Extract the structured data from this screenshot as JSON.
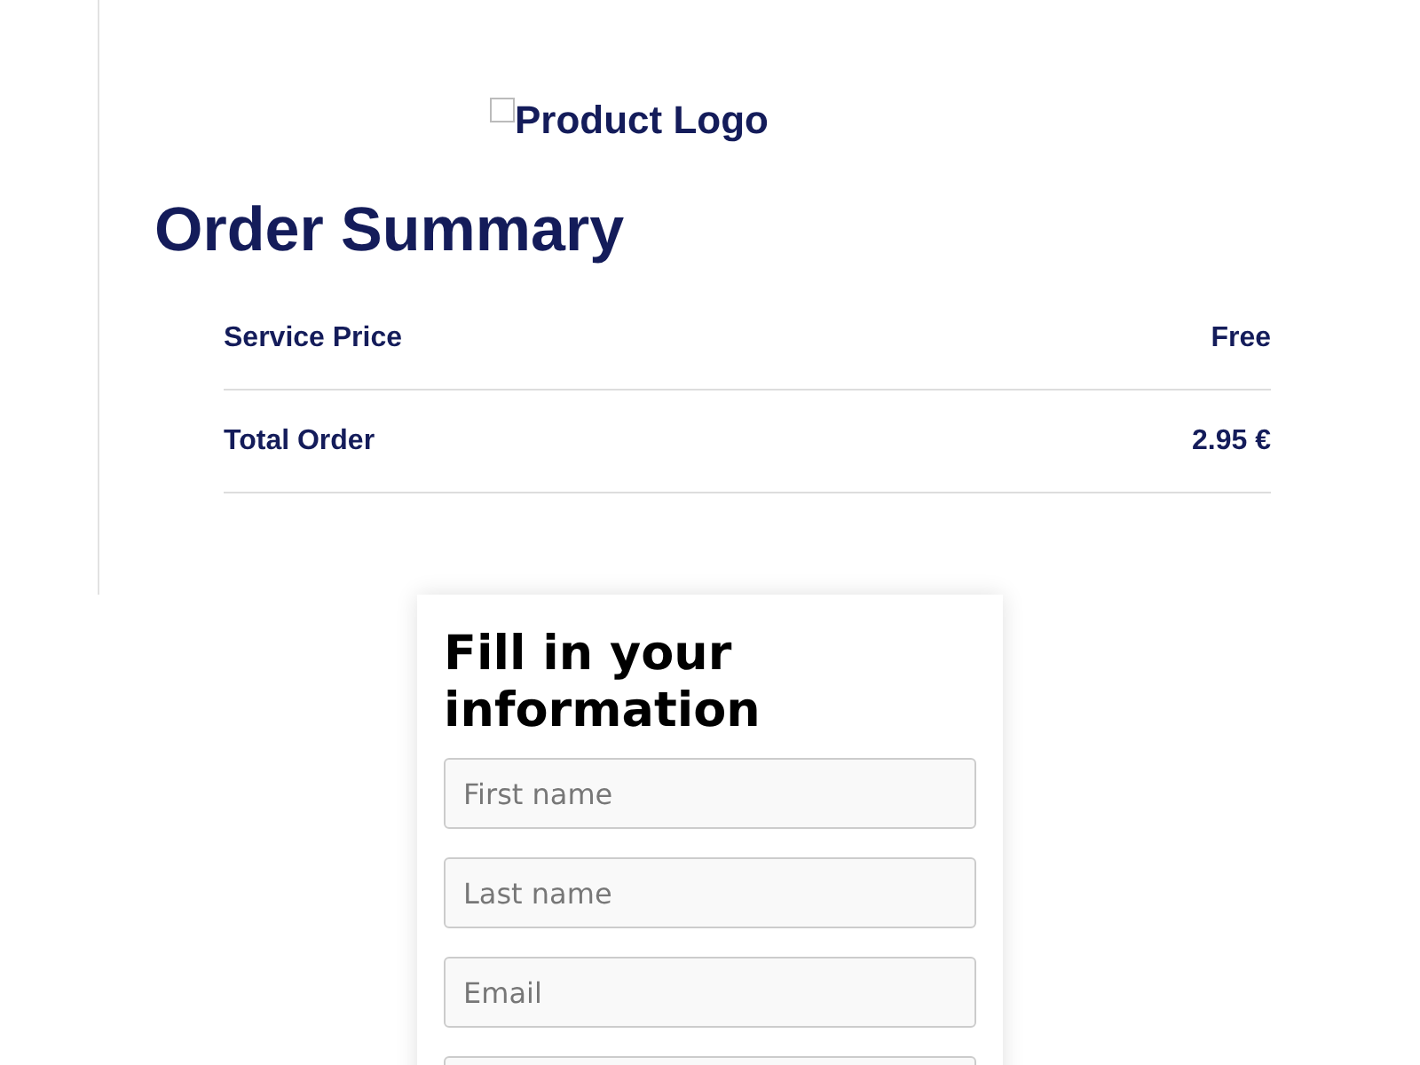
{
  "logo": {
    "alt_text": "Product Logo"
  },
  "order_summary": {
    "title": "Order Summary",
    "rows": [
      {
        "label": "Service Price",
        "value": "Free"
      },
      {
        "label": "Total Order",
        "value": "2.95 €"
      }
    ]
  },
  "form": {
    "title": "Fill in your information",
    "fields": [
      {
        "kind": "text",
        "placeholder": "First name"
      },
      {
        "kind": "text",
        "placeholder": "Last name"
      },
      {
        "kind": "text",
        "placeholder": "Email"
      },
      {
        "kind": "text"
      }
    ]
  }
}
